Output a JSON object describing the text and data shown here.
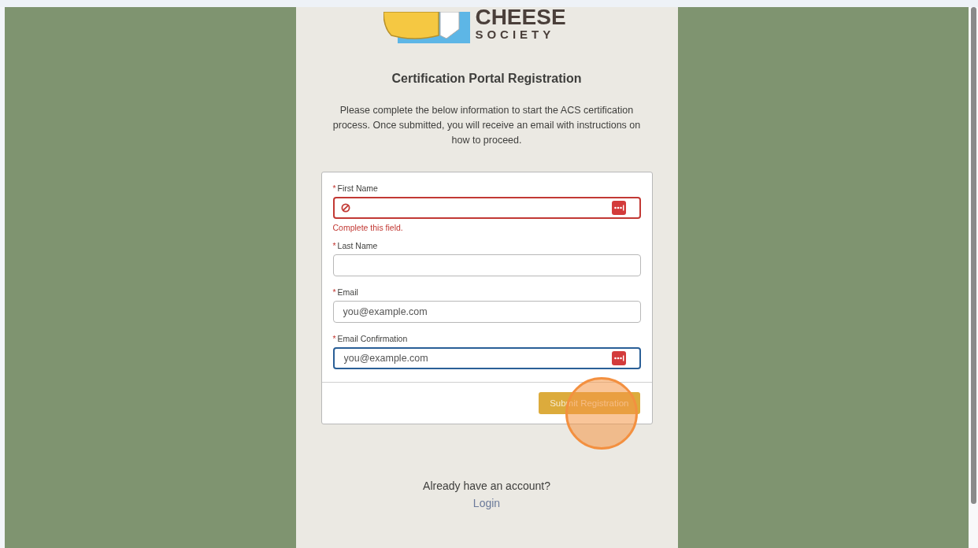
{
  "logo": {
    "line_1": "CHEESE",
    "line_2": "SOCIETY"
  },
  "title": "Certification Portal Registration",
  "intro": "Please complete the below information to start the ACS certification process. Once submitted, you will receive an email with instructions on how to proceed.",
  "form": {
    "fields": [
      {
        "label": "First Name",
        "required_mark": "*",
        "error": true,
        "focused": false,
        "autofill_icon": true,
        "error_message": "Complete this field."
      },
      {
        "label": "Last Name",
        "required_mark": "*",
        "error": false,
        "focused": false,
        "autofill_icon": false
      },
      {
        "label": "Email",
        "required_mark": "*",
        "error": false,
        "focused": false,
        "autofill_icon": false,
        "placeholder": "you@example.com"
      },
      {
        "label": "Email Confirmation",
        "required_mark": "*",
        "error": false,
        "focused": true,
        "autofill_icon": true,
        "placeholder": "you@example.com"
      }
    ],
    "submit": "Submit Registration",
    "click_marker": true
  },
  "account_prompt": "Already have an account?",
  "login_link": "Login"
}
